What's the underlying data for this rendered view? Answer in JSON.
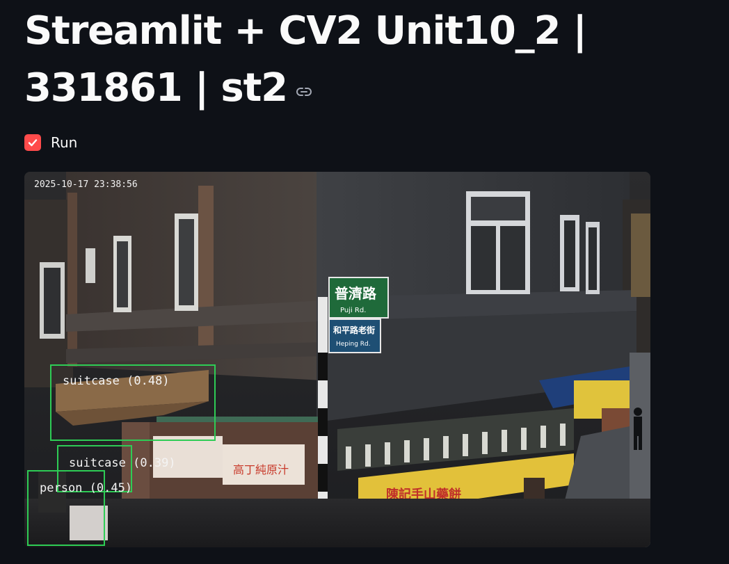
{
  "page": {
    "title": "Streamlit + CV2 Unit10_2 | 331861 | st2"
  },
  "controls": {
    "run_label": "Run",
    "run_checked": true
  },
  "camera": {
    "timestamp": "2025-10-17 23:38:56",
    "signs": {
      "top_cn": "普濟路",
      "top_en": "Puji Rd.",
      "bottom_cn": "和平路老街",
      "bottom_en": "Heping Rd."
    },
    "shop_signs": {
      "left_red": "陳記手山藥餅",
      "awning_left": "高丁純原汁"
    },
    "detections": [
      {
        "label": "suitcase",
        "score": "(0.48)"
      },
      {
        "label": "suitcase",
        "score": "(0.39)"
      },
      {
        "label": "person",
        "score": "(0.45)"
      }
    ]
  },
  "colors": {
    "background": "#0e1117",
    "accent": "#ff4b4b",
    "text": "#fafafa",
    "detection_box": "#2ecc55"
  }
}
